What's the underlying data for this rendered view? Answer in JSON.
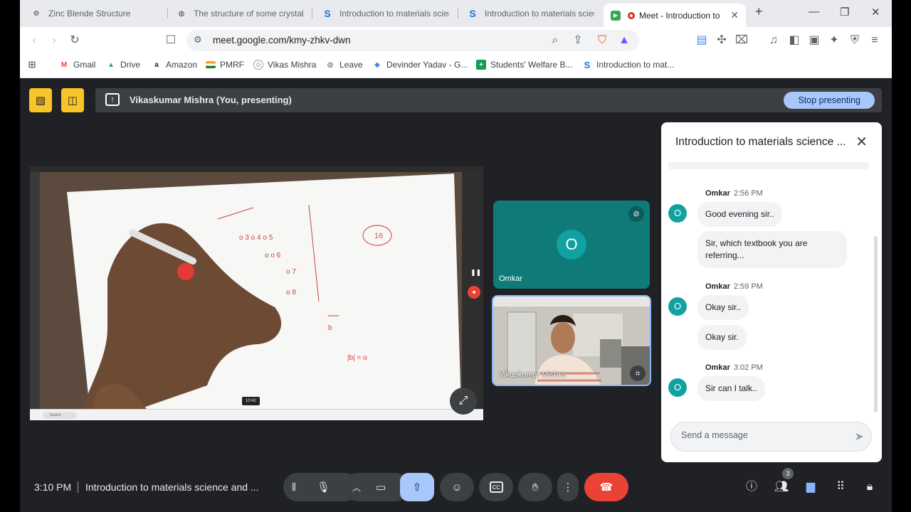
{
  "browser": {
    "tabs": [
      {
        "title": "Zinc Blende Structure",
        "icon": "gear-icon"
      },
      {
        "title": "The structure of some crystals -",
        "icon": "globe-icon"
      },
      {
        "title": "Introduction to materials scien",
        "icon": "s-logo-icon"
      },
      {
        "title": "Introduction to materials scien",
        "icon": "s-logo-icon"
      },
      {
        "title": "Meet - Introduction to",
        "icon": "meet-icon"
      }
    ],
    "new_tab": "+",
    "url": "meet.google.com/kmy-zhkv-dwn",
    "bookmarks": [
      {
        "label": "Gmail",
        "icon": "gmail-icon",
        "color": "#ea4335"
      },
      {
        "label": "Drive",
        "icon": "drive-icon",
        "color": "#34a853"
      },
      {
        "label": "Amazon",
        "icon": "amazon-icon",
        "color": "#222222"
      },
      {
        "label": "PMRF",
        "icon": "flag-icon",
        "color": "#ff9933"
      },
      {
        "label": "Vikas Mishra",
        "icon": "profile-icon",
        "color": "#5f6368"
      },
      {
        "label": "Leave",
        "icon": "globe-icon",
        "color": "#5f6368"
      },
      {
        "label": "Devinder Yadav - G...",
        "icon": "scholar-icon",
        "color": "#4285f4"
      },
      {
        "label": "Students' Welfare B...",
        "icon": "plus-icon",
        "color": "#0f9d58"
      },
      {
        "label": "Introduction to mat...",
        "icon": "s-logo-icon",
        "color": "#1a73e8"
      }
    ]
  },
  "meet": {
    "presenting_text": "Vikaskumar Mishra (You, presenting)",
    "stop_presenting": "Stop presenting",
    "presentation_timer": "10:42",
    "search_label": "Search",
    "participants": [
      {
        "name": "Omkar",
        "initial": "O",
        "muted": true
      },
      {
        "name": "Vikaskumar Mishra"
      }
    ],
    "chat": {
      "title": "Introduction to materials science ...",
      "messages": [
        {
          "sender": "Omkar",
          "time": "2:56 PM",
          "initial": "O",
          "texts": [
            "Good evening sir..",
            "Sir, which textbook you are referring..."
          ]
        },
        {
          "sender": "Omkar",
          "time": "2:59 PM",
          "initial": "O",
          "texts": [
            "Okay sir..",
            "Okay sir."
          ]
        },
        {
          "sender": "Omkar",
          "time": "3:02 PM",
          "initial": "O",
          "texts": [
            "Sir can I talk.."
          ]
        }
      ],
      "placeholder": "Send a message"
    },
    "clock": "3:10 PM",
    "meeting_title": "Introduction to materials science and ...",
    "people_count": "3",
    "colors": {
      "accent": "#a8c7fa",
      "hangup": "#ea4335",
      "teal": "#0f7b78",
      "yellow": "#f9c429"
    }
  }
}
